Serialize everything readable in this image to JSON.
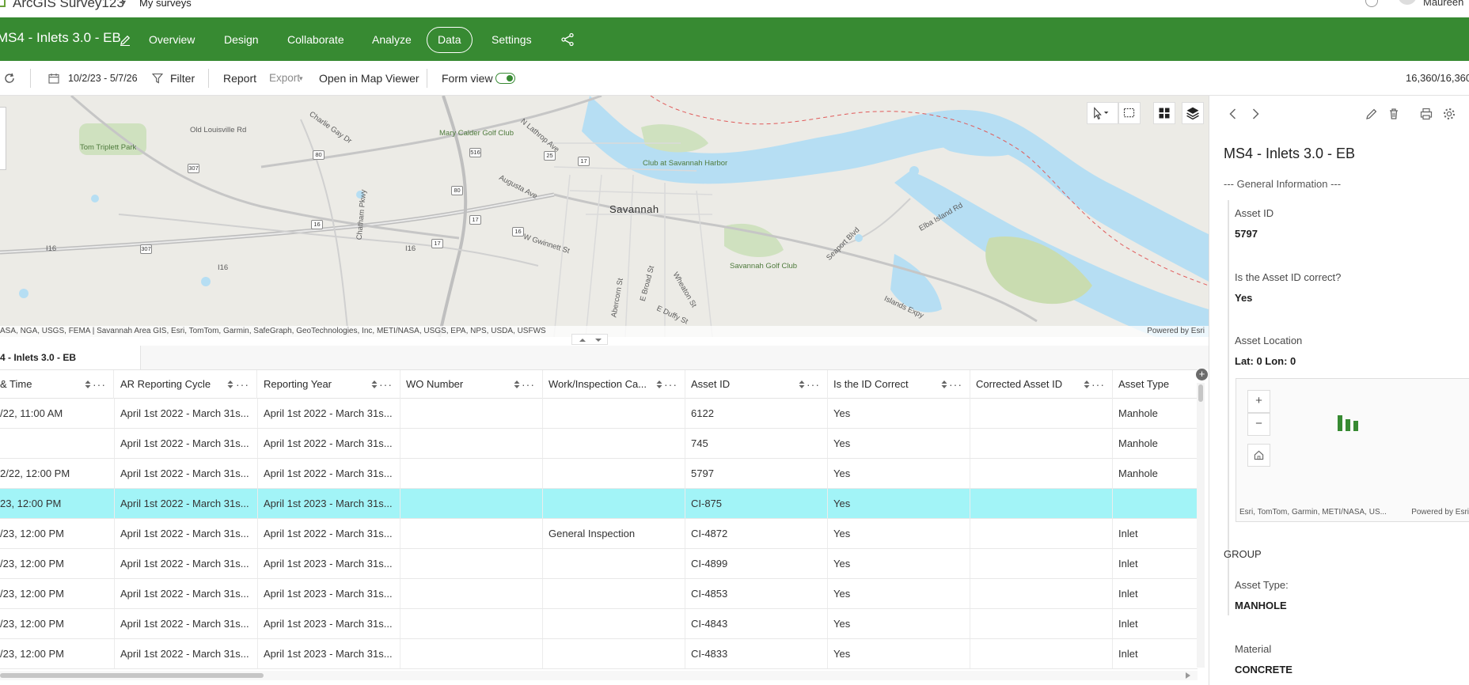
{
  "topbar": {
    "app_name": "ArcGIS Survey123",
    "my_surveys": "My surveys",
    "user_name": "Maureen"
  },
  "nav": {
    "survey_title": "MS4 - Inlets 3.0 - EB",
    "tabs": [
      "Overview",
      "Design",
      "Collaborate",
      "Analyze",
      "Data",
      "Settings"
    ],
    "active_tab": "Data"
  },
  "toolbar": {
    "date_range": "10/2/23 - 5/7/26",
    "filter": "Filter",
    "report": "Report",
    "export": "Export",
    "open_map_viewer": "Open in Map Viewer",
    "form_view": "Form view",
    "form_view_on": true,
    "record_count": "16,360/16,360"
  },
  "map": {
    "labels": {
      "tom_triplett_park": "Tom Triplett Park",
      "old_louisville_rd": "Old Louisville Rd",
      "mary_calder": "Mary Calder Golf Club",
      "club_savannah_harbor": "Club at Savannah Harbor",
      "savannah": "Savannah",
      "augusta_ave": "Augusta Ave",
      "chatham_pkwy": "Chatham Pkwy",
      "w_gwinnett": "W Gwinnett St",
      "savannah_golf": "Savannah Golf Club",
      "i16_a": "I16",
      "i16_b": "I16",
      "i16_c": "I16",
      "islands_expy": "Islands Expy",
      "seaport_blvd": "Seaport Blvd",
      "elba_island": "Elba Island Rd",
      "n_lathrop": "N Lathrop Ave",
      "charlie_gay": "Charlie Gay Dr",
      "e_broad": "E Broad St",
      "abercorn": "Abercorn St",
      "wheaton": "Wheaton St",
      "e_duffy": "E Duffy St"
    },
    "shields": [
      "80",
      "307",
      "516",
      "25",
      "17",
      "80",
      "16",
      "17",
      "16",
      "17",
      "307"
    ],
    "attribution": "ASA, NGA, USGS, FEMA | Savannah Area GIS, Esri, TomTom, Garmin, SafeGraph, GeoTechnologies, Inc, METI/NASA, USGS, EPA, NPS, USDA, USFWS",
    "powered_by": "Powered by Esri"
  },
  "table": {
    "tab_label": "4 - Inlets 3.0 - EB",
    "columns": [
      "& Time",
      "AR Reporting Cycle",
      "Reporting Year",
      "WO Number",
      "Work/Inspection Ca...",
      "Asset ID",
      "Is the ID Correct",
      "Corrected Asset ID",
      "Asset Type"
    ],
    "rows": [
      [
        "/22, 11:00 AM",
        "April 1st 2022 - March 31s...",
        "April 1st 2022 - March 31s...",
        "",
        "",
        "6122",
        "Yes",
        "",
        "Manhole"
      ],
      [
        "",
        "April 1st 2022 - March 31s...",
        "April 1st 2022 - March 31s...",
        "",
        "",
        "745",
        "Yes",
        "",
        "Manhole"
      ],
      [
        "2/22, 12:00 PM",
        "April 1st 2022 - March 31s...",
        "April 1st 2022 - March 31s...",
        "",
        "",
        "5797",
        "Yes",
        "",
        "Manhole"
      ],
      [
        "23, 12:00 PM",
        "April 1st 2022 - March 31s...",
        "April 1st 2023 - March 31s...",
        "",
        "",
        "CI-875",
        "Yes",
        "",
        ""
      ],
      [
        "/23, 12:00 PM",
        "April 1st 2022 - March 31s...",
        "April 1st 2022 - March 31s...",
        "",
        "General Inspection",
        "CI-4872",
        "Yes",
        "",
        "Inlet"
      ],
      [
        "/23, 12:00 PM",
        "April 1st 2022 - March 31s...",
        "April 1st 2023 - March 31s...",
        "",
        "",
        "CI-4899",
        "Yes",
        "",
        "Inlet"
      ],
      [
        "/23, 12:00 PM",
        "April 1st 2022 - March 31s...",
        "April 1st 2023 - March 31s...",
        "",
        "",
        "CI-4853",
        "Yes",
        "",
        "Inlet"
      ],
      [
        "/23, 12:00 PM",
        "April 1st 2022 - March 31s...",
        "April 1st 2023 - March 31s...",
        "",
        "",
        "CI-4843",
        "Yes",
        "",
        "Inlet"
      ],
      [
        "/23, 12:00 PM",
        "April 1st 2022 - March 31s...",
        "April 1st 2023 - March 31s...",
        "",
        "",
        "CI-4833",
        "Yes",
        "",
        "Inlet"
      ]
    ],
    "selected_row": 3
  },
  "panel": {
    "title": "MS4 - Inlets 3.0 - EB",
    "section": "--- General Information ---",
    "fields": [
      {
        "label": "Asset ID",
        "value": "5797"
      },
      {
        "label": "Is the Asset ID correct?",
        "value": "Yes"
      },
      {
        "label": "Asset Location",
        "value": "Lat: 0 Lon: 0"
      }
    ],
    "minimap_attribution": "Esri, TomTom, Garmin, METI/NASA, US...",
    "minimap_powered": "Powered by Esri",
    "group_title": "GROUP",
    "group_fields": [
      {
        "label": "Asset Type:",
        "value": "MANHOLE"
      },
      {
        "label": "Material",
        "value": "CONCRETE"
      }
    ]
  },
  "colors": {
    "brand_green": "#378a32",
    "selected_row": "#a2f4f7",
    "water": "#b6def3"
  }
}
